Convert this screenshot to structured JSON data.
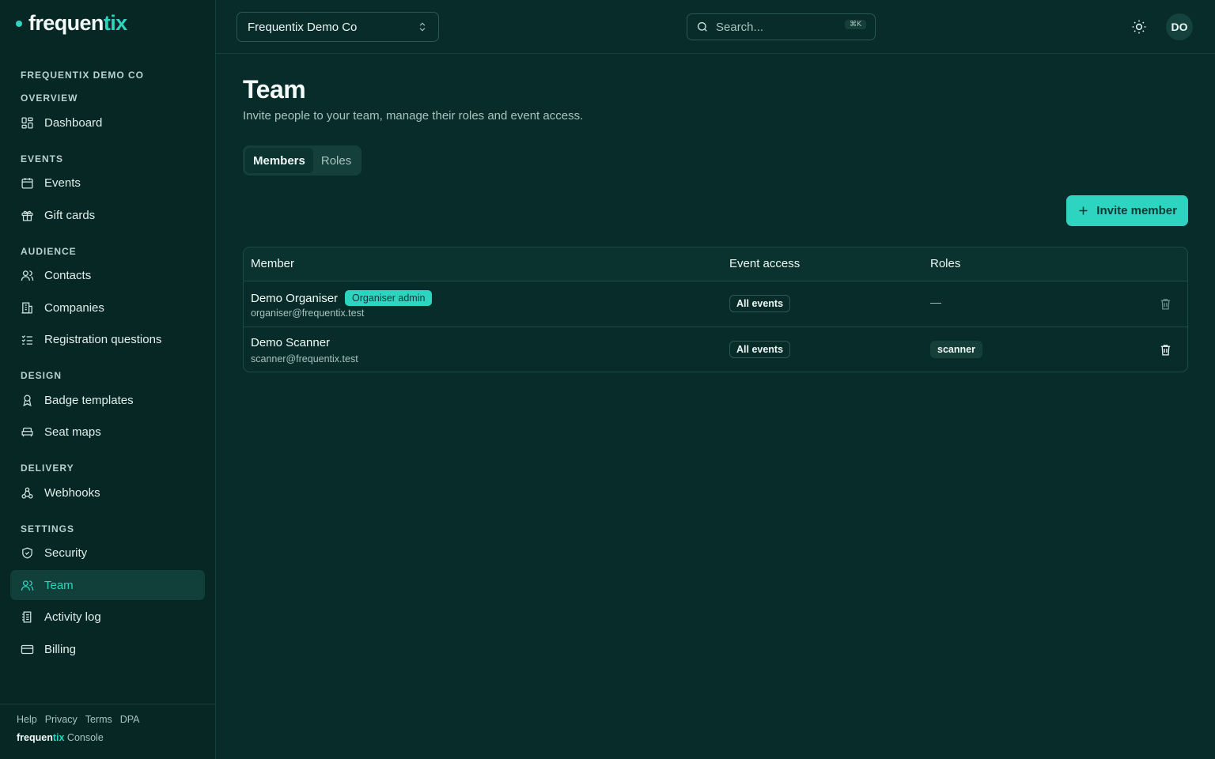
{
  "brand": {
    "name_a": "frequen",
    "name_b": "tix"
  },
  "sidebar": {
    "org": "FREQUENTIX DEMO CO",
    "groups": [
      {
        "label": "OVERVIEW",
        "items": [
          {
            "label": "Dashboard",
            "icon": "dashboard-icon"
          }
        ]
      },
      {
        "label": "EVENTS",
        "items": [
          {
            "label": "Events",
            "icon": "calendar-icon"
          },
          {
            "label": "Gift cards",
            "icon": "gift-icon"
          }
        ]
      },
      {
        "label": "AUDIENCE",
        "items": [
          {
            "label": "Contacts",
            "icon": "users-icon"
          },
          {
            "label": "Companies",
            "icon": "building-icon"
          },
          {
            "label": "Registration questions",
            "icon": "list-check-icon"
          }
        ]
      },
      {
        "label": "DESIGN",
        "items": [
          {
            "label": "Badge templates",
            "icon": "badge-icon"
          },
          {
            "label": "Seat maps",
            "icon": "seat-icon"
          }
        ]
      },
      {
        "label": "DELIVERY",
        "items": [
          {
            "label": "Webhooks",
            "icon": "webhook-icon"
          }
        ]
      },
      {
        "label": "SETTINGS",
        "items": [
          {
            "label": "Security",
            "icon": "shield-icon"
          },
          {
            "label": "Team",
            "icon": "team-icon",
            "active": true
          },
          {
            "label": "Activity log",
            "icon": "log-icon"
          },
          {
            "label": "Billing",
            "icon": "card-icon"
          }
        ]
      }
    ],
    "footer": {
      "links": [
        "Help",
        "Privacy",
        "Terms",
        "DPA"
      ],
      "console_a": "frequen",
      "console_b": "tix",
      "console_c": "Console"
    }
  },
  "topbar": {
    "org_select": "Frequentix Demo Co",
    "search_placeholder": "Search...",
    "search_shortcut": "⌘K",
    "avatar": "DO"
  },
  "page": {
    "title": "Team",
    "subtitle": "Invite people to your team, manage their roles and event access.",
    "tabs": [
      "Members",
      "Roles"
    ],
    "invite_label": "Invite member"
  },
  "table": {
    "headers": [
      "Member",
      "Event access",
      "Roles"
    ],
    "rows": [
      {
        "name": "Demo Organiser",
        "badge": "Organiser admin",
        "email": "organiser@frequentix.test",
        "access": "All events",
        "role": "—"
      },
      {
        "name": "Demo Scanner",
        "email": "scanner@frequentix.test",
        "access": "All events",
        "role": "scanner"
      }
    ]
  },
  "colors": {
    "accent": "#2dd4bf",
    "background": "#072c29",
    "sidebar": "#062724"
  }
}
